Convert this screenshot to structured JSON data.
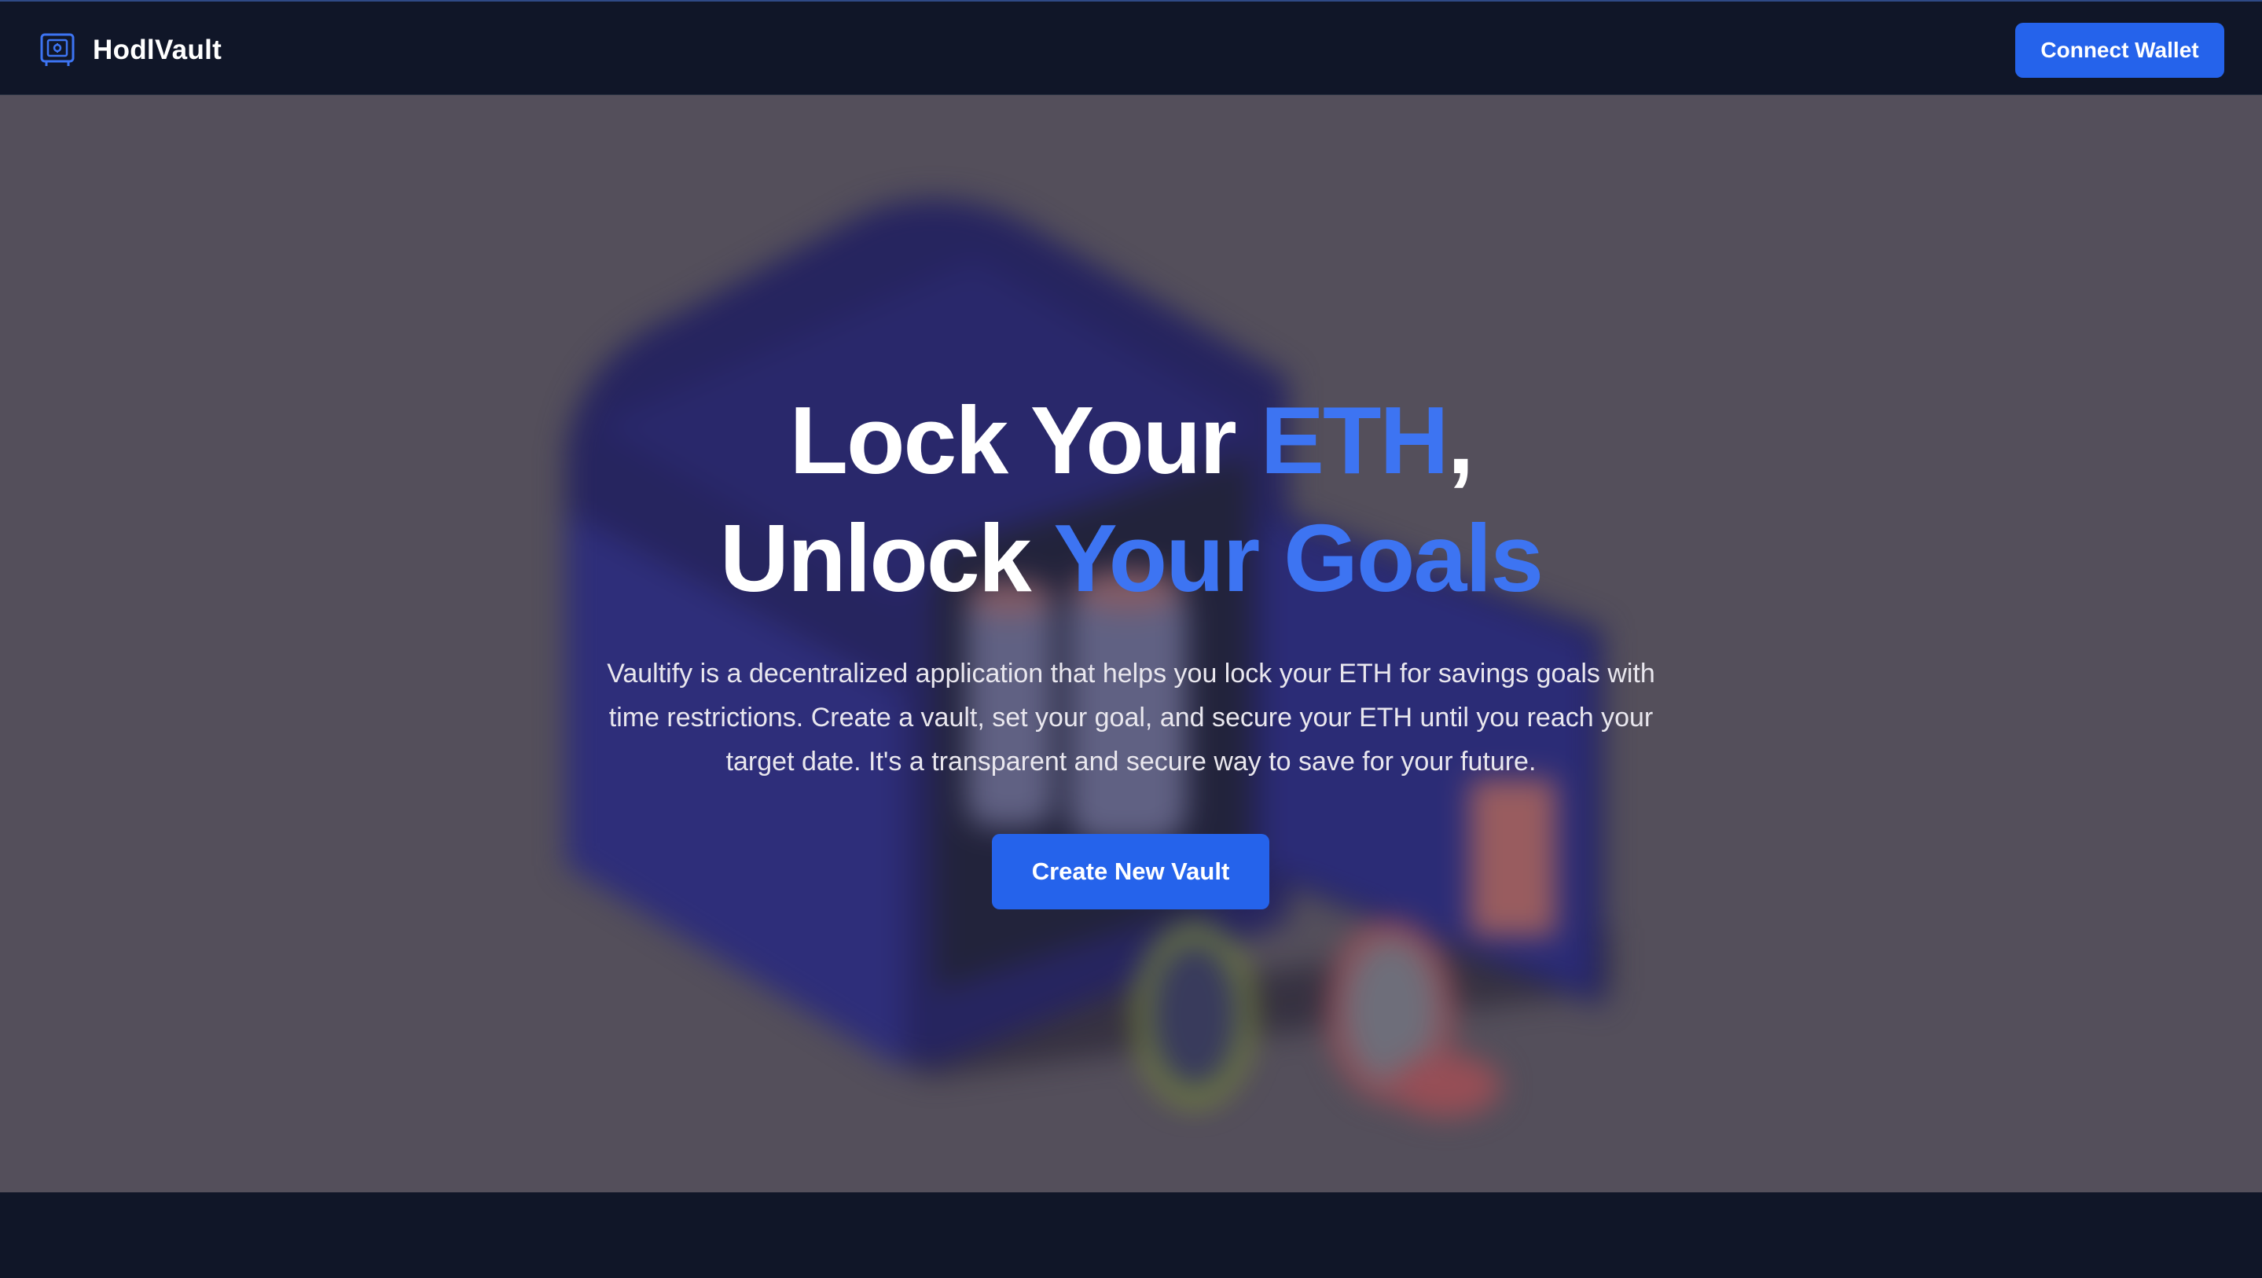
{
  "navbar": {
    "brand_name": "HodlVault",
    "brand_icon": "safe-icon",
    "connect_label": "Connect Wallet"
  },
  "hero": {
    "background_image": "blurred-vault-with-coins-illustration",
    "headline_line1_prefix": "Lock Your ",
    "headline_line1_accent": "ETH",
    "headline_line1_suffix": ",",
    "headline_line2_prefix": "Unlock ",
    "headline_line2_accent": "Your Goals",
    "description": "Vaultify is a decentralized application that helps you lock your ETH for savings goals with time restrictions. Create a vault, set your goal, and secure your ETH until you reach your target date. It's a transparent and secure way to save for your future.",
    "cta_label": "Create New Vault"
  },
  "colors": {
    "background": "#101628",
    "accent": "#3d74f2",
    "button": "#2563eb",
    "hero_bg": "#5e5964"
  }
}
